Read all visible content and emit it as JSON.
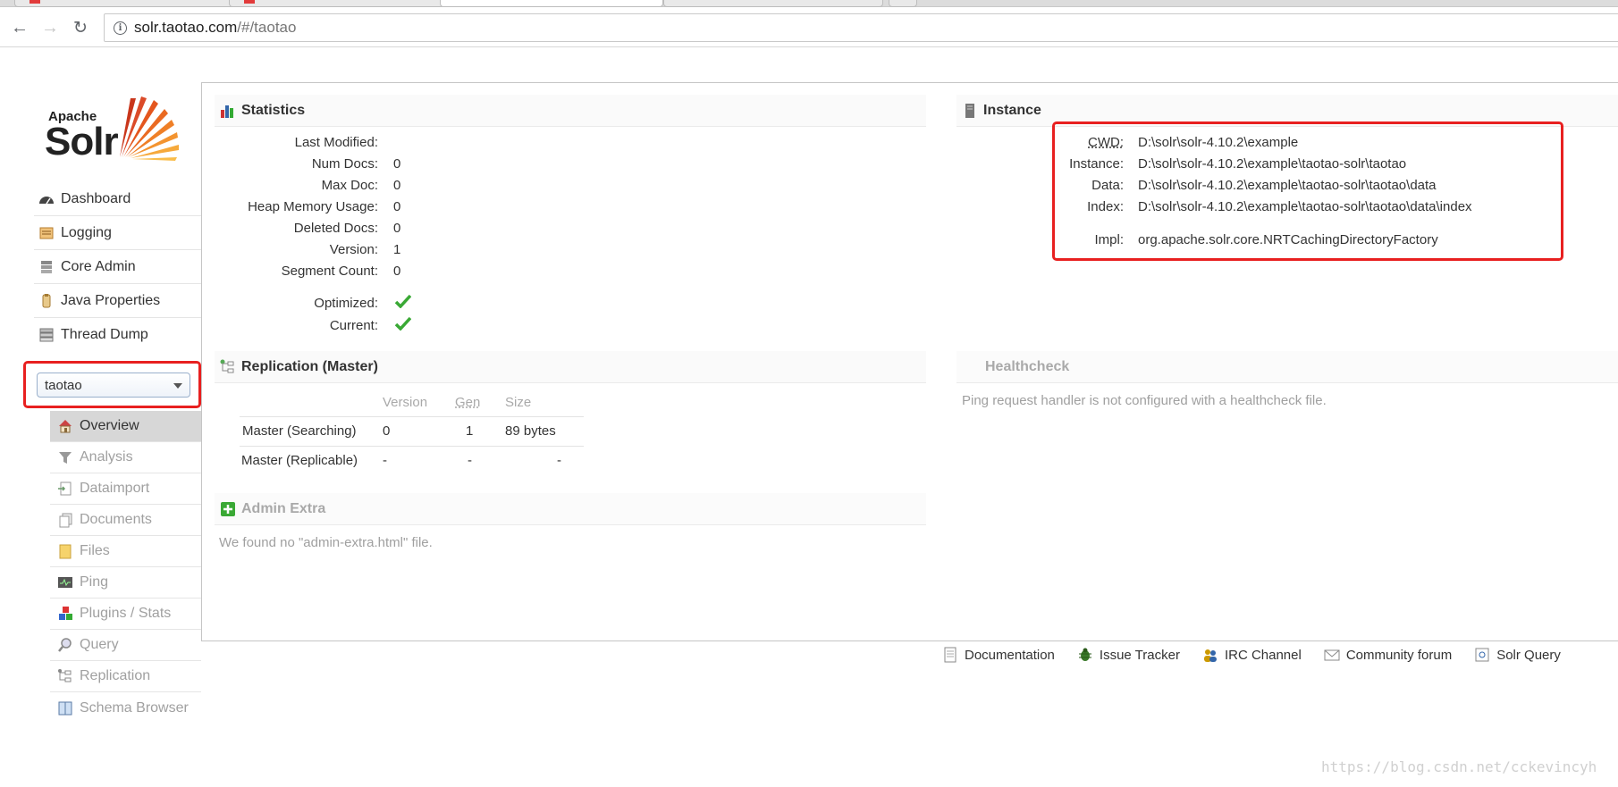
{
  "browser": {
    "url_host": "solr.taotao.com",
    "url_path": "/#/taotao"
  },
  "logo": {
    "apache": "Apache",
    "solr": "Solr"
  },
  "main_nav": [
    {
      "label": "Dashboard",
      "icon": "dashboard-icon"
    },
    {
      "label": "Logging",
      "icon": "logging-icon"
    },
    {
      "label": "Core Admin",
      "icon": "core-admin-icon"
    },
    {
      "label": "Java Properties",
      "icon": "java-properties-icon"
    },
    {
      "label": "Thread Dump",
      "icon": "thread-dump-icon"
    }
  ],
  "core_selector": {
    "selected": "taotao"
  },
  "core_nav": [
    {
      "label": "Overview",
      "icon": "home-icon"
    },
    {
      "label": "Analysis",
      "icon": "funnel-icon"
    },
    {
      "label": "Dataimport",
      "icon": "dataimport-icon"
    },
    {
      "label": "Documents",
      "icon": "documents-icon"
    },
    {
      "label": "Files",
      "icon": "folder-icon"
    },
    {
      "label": "Ping",
      "icon": "ping-icon"
    },
    {
      "label": "Plugins / Stats",
      "icon": "plugins-icon"
    },
    {
      "label": "Query",
      "icon": "magnifier-icon"
    },
    {
      "label": "Replication",
      "icon": "replication-icon"
    },
    {
      "label": "Schema Browser",
      "icon": "book-icon"
    }
  ],
  "statistics": {
    "title": "Statistics",
    "rows": [
      {
        "key": "Last Modified:",
        "value": ""
      },
      {
        "key": "Num Docs:",
        "value": "0"
      },
      {
        "key": "Max Doc:",
        "value": "0"
      },
      {
        "key": "Heap Memory Usage:",
        "value": "0"
      },
      {
        "key": "Deleted Docs:",
        "value": "0"
      },
      {
        "key": "Version:",
        "value": "1"
      },
      {
        "key": "Segment Count:",
        "value": "0"
      }
    ],
    "optimized_label": "Optimized:",
    "current_label": "Current:"
  },
  "instance": {
    "title": "Instance",
    "rows": [
      {
        "key": "CWD:",
        "value": "D:\\solr\\solr-4.10.2\\example"
      },
      {
        "key": "Instance:",
        "value": "D:\\solr\\solr-4.10.2\\example\\taotao-solr\\taotao"
      },
      {
        "key": "Data:",
        "value": "D:\\solr\\solr-4.10.2\\example\\taotao-solr\\taotao\\data"
      },
      {
        "key": "Index:",
        "value": "D:\\solr\\solr-4.10.2\\example\\taotao-solr\\taotao\\data\\index"
      }
    ],
    "impl_key": "Impl:",
    "impl_value": "org.apache.solr.core.NRTCachingDirectoryFactory"
  },
  "replication": {
    "title": "Replication (Master)",
    "headers": {
      "version": "Version",
      "gen": "Gen",
      "size": "Size"
    },
    "rows": [
      {
        "label": "Master (Searching)",
        "version": "0",
        "gen": "1",
        "size": "89 bytes"
      },
      {
        "label": "Master (Replicable)",
        "version": "-",
        "gen": "-",
        "size": "-"
      }
    ]
  },
  "healthcheck": {
    "title": "Healthcheck",
    "message": "Ping request handler is not configured with a healthcheck file."
  },
  "admin_extra": {
    "title": "Admin Extra",
    "message": "We found no \"admin-extra.html\" file."
  },
  "footer": [
    {
      "label": "Documentation",
      "icon": "documentation-icon"
    },
    {
      "label": "Issue Tracker",
      "icon": "bug-icon"
    },
    {
      "label": "IRC Channel",
      "icon": "irc-icon"
    },
    {
      "label": "Community forum",
      "icon": "mail-icon"
    },
    {
      "label": "Solr Query",
      "icon": "query-syntax-icon"
    }
  ],
  "watermark": "https://blog.csdn.net/cckevincyh",
  "colors": {
    "highlight_box": "#e82020",
    "check": "#3aa935",
    "accent": "#d9411e"
  }
}
